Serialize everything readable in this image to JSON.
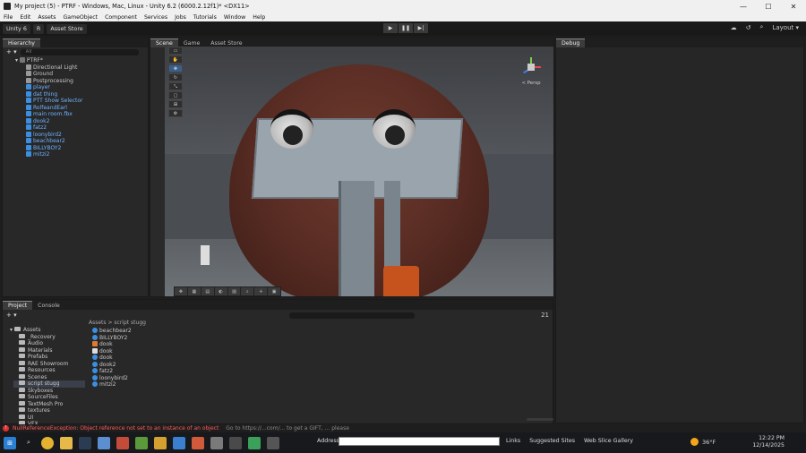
{
  "window": {
    "title": "My project (5) - PTRF - Windows, Mac, Linux - Unity 6.2 (6000.2.12f1)* <DX11>",
    "min": "—",
    "max": "☐",
    "close": "✕"
  },
  "menu": [
    "File",
    "Edit",
    "Assets",
    "GameObject",
    "Component",
    "Services",
    "Jobs",
    "Tutorials",
    "Window",
    "Help"
  ],
  "toolbar": {
    "account": "Unity 6",
    "r_label": "R",
    "asset_store": "Asset Store",
    "layout": "Layout"
  },
  "hierarchy": {
    "tab": "Hierarchy",
    "search": "All",
    "root": "PTRF*",
    "items": [
      "Directional Light",
      "Ground",
      "Postprocessing",
      "player",
      "dat thing",
      "PTT Show Selector",
      "RolfeandEarl",
      "main room.fbx",
      "dook2",
      "fatz2",
      "loonybird2",
      "beachbear2",
      "BILLYBOY2",
      "mitzi2"
    ]
  },
  "scene": {
    "tabs": [
      "Scene",
      "Game",
      "Asset Store"
    ],
    "persp": "< Persp"
  },
  "debug": {
    "tab": "Debug"
  },
  "project": {
    "tabs": [
      "Project",
      "Console"
    ],
    "breadcrumb_root": "Assets",
    "breadcrumb_sep": ">",
    "breadcrumb_leaf": "script stugg",
    "count": "21",
    "tree_root": "Assets",
    "folders": [
      "_Recovery",
      "Audio",
      "Materials",
      "Prefabs",
      "RAE Showroom",
      "Resources",
      "Scenes",
      "script stugg",
      "Skyboxes",
      "SourceFiles",
      "TextMesh Pro",
      "textures",
      "UI",
      "VFX"
    ],
    "files": [
      "beachbear2",
      "BILLYBOY2",
      "dook",
      "dook",
      "dook",
      "dook2",
      "fatz2",
      "loonybird2",
      "mitzi2"
    ]
  },
  "status": {
    "message": "NullReferenceException: Object reference not set to an instance of an object",
    "overlay": "Go to https://...com/... to get a GIFT, ... please"
  },
  "taskbar": {
    "address_label": "Address",
    "links": "Links",
    "suggested": "Suggested Sites",
    "gallery": "Web Slice Gallery",
    "temp": "36°F",
    "time": "12:22 PM",
    "date": "12/14/2025"
  },
  "colors": {
    "accent": "#6fb3ff",
    "error": "#ff5a5a",
    "hood": "#5a2d24",
    "orange": "#c6531d"
  }
}
